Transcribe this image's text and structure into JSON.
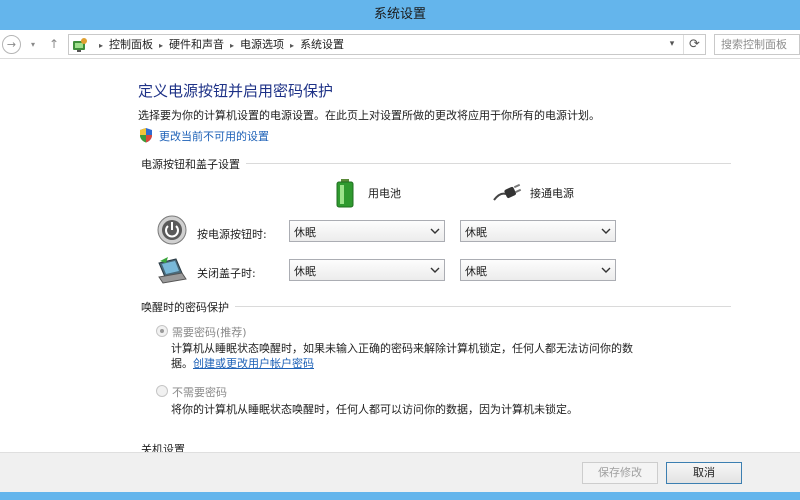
{
  "window": {
    "title": "系统设置"
  },
  "nav": {
    "back_glyph": "→",
    "dropdown_glyph": "▾",
    "up_glyph": "↑",
    "breadcrumbs": [
      "控制面板",
      "硬件和声音",
      "电源选项",
      "系统设置"
    ],
    "separator_glyph": "▸",
    "address_dropdown_glyph": "▾",
    "refresh_glyph": "⟳",
    "search": {
      "placeholder": "搜索控制面板",
      "value": ""
    },
    "icons": [
      "control-panel-icon",
      "chevron-right-icon",
      "refresh-icon",
      "chevron-down-icon"
    ]
  },
  "page": {
    "title": "定义电源按钮并启用密码保护",
    "description": "选择要为你的计算机设置的电源设置。在此页上对设置所做的更改将应用于你所有的电源计划。",
    "change_link": "更改当前不可用的设置"
  },
  "power_section": {
    "header": "电源按钮和盖子设置",
    "columns": [
      {
        "label": "用电池",
        "icon": "battery-icon"
      },
      {
        "label": "接通电源",
        "icon": "power-plug-icon"
      }
    ],
    "rows": [
      {
        "label": "按电源按钮时:",
        "icon": "power-button-icon",
        "battery": "休眠",
        "plugged": "休眠"
      },
      {
        "label": "关闭盖子时:",
        "icon": "laptop-lid-icon",
        "battery": "休眠",
        "plugged": "休眠"
      }
    ]
  },
  "password_section": {
    "header": "唤醒时的密码保护",
    "require": {
      "label": "需要密码(推荐)",
      "checked": true,
      "note": "计算机从睡眠状态唤醒时，如果未输入正确的密码来解除计算机锁定，任何人都无法访问你的数",
      "note_end": "据。",
      "link": "创建或更改用户帐户密码"
    },
    "no_require": {
      "label": "不需要密码",
      "checked": false,
      "note": "将你的计算机从睡眠状态唤醒时，任何人都可以访问你的数据，因为计算机未锁定。"
    }
  },
  "shutdown_section": {
    "header": "关机设置"
  },
  "footer": {
    "save_label": "保存修改",
    "cancel_label": "取消"
  },
  "colors": {
    "titlebar": "#64b5ec",
    "title_text": "#1e3287",
    "link": "#1d61b7"
  }
}
